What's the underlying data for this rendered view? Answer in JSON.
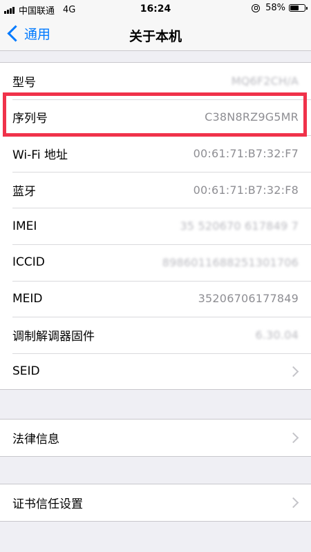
{
  "status_bar": {
    "carrier": "中国联通",
    "network": "4G",
    "time": "16:24",
    "battery_percent": "58%",
    "battery_level": 0.58
  },
  "nav": {
    "back_label": "通用",
    "title": "关于本机"
  },
  "groups": [
    {
      "rows": [
        {
          "label": "型号",
          "value": "MQ6F2CH/A",
          "blurred": true,
          "chevron": false
        },
        {
          "label": "序列号",
          "value": "C38N8RZ9G5MR",
          "blurred": false,
          "chevron": false
        },
        {
          "label": "Wi-Fi 地址",
          "value": "00:61:71:B7:32:F7",
          "blurred": false,
          "chevron": false
        },
        {
          "label": "蓝牙",
          "value": "00:61:71:B7:32:F8",
          "blurred": false,
          "chevron": false
        },
        {
          "label": "IMEI",
          "value": "35 520670 617849 7",
          "blurred": true,
          "chevron": false
        },
        {
          "label": "ICCID",
          "value": "8986011688251301706",
          "blurred": true,
          "chevron": false
        },
        {
          "label": "MEID",
          "value": "35206706177849",
          "blurred": false,
          "chevron": false
        },
        {
          "label": "调制解调器固件",
          "value": "6.30.04",
          "blurred": true,
          "chevron": false
        },
        {
          "label": "SEID",
          "value": "",
          "blurred": false,
          "chevron": true
        }
      ]
    },
    {
      "rows": [
        {
          "label": "法律信息",
          "value": "",
          "blurred": false,
          "chevron": true
        }
      ]
    },
    {
      "rows": [
        {
          "label": "证书信任设置",
          "value": "",
          "blurred": false,
          "chevron": true
        }
      ]
    }
  ],
  "colors": {
    "accent": "#007aff",
    "highlight": "#f0324a",
    "background": "#efeff4"
  }
}
